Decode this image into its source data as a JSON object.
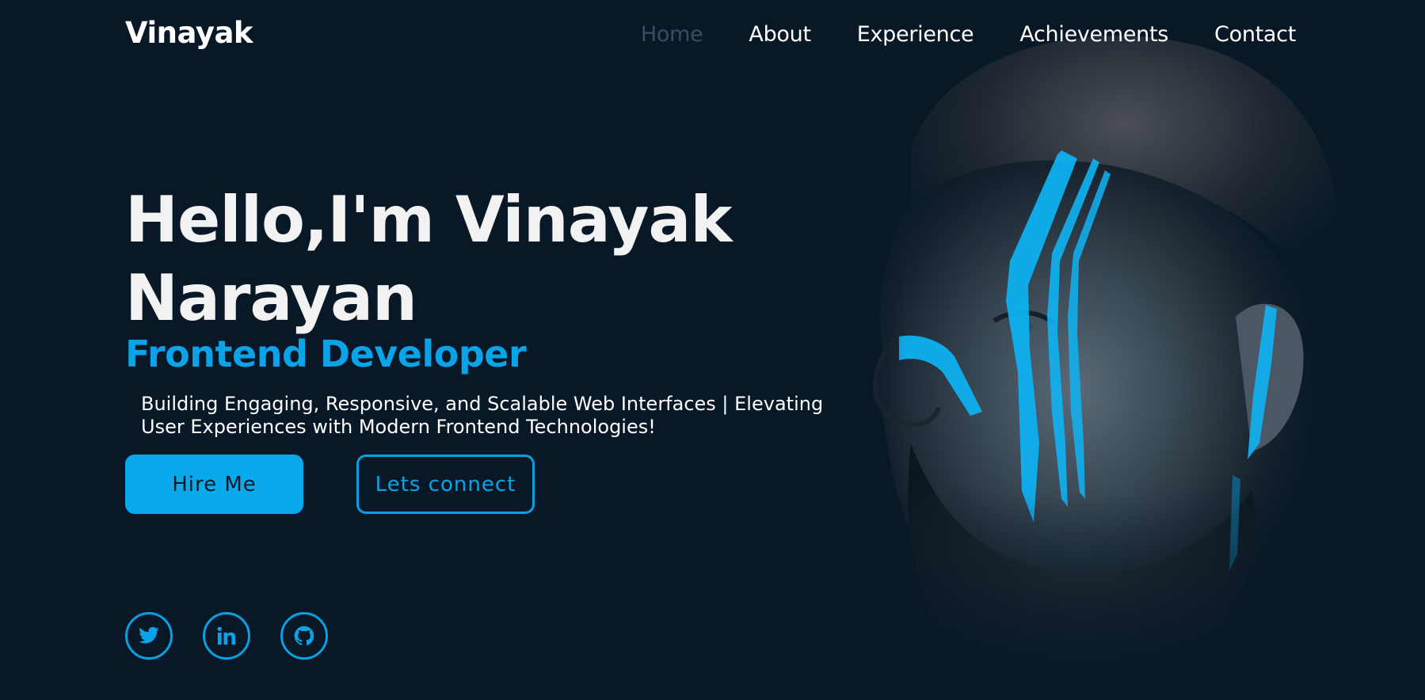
{
  "header": {
    "logo": "Vinayak",
    "nav": [
      {
        "label": "Home",
        "active": true
      },
      {
        "label": "About",
        "active": false
      },
      {
        "label": "Experience",
        "active": false
      },
      {
        "label": "Achievements",
        "active": false
      },
      {
        "label": "Contact",
        "active": false
      }
    ]
  },
  "hero": {
    "title_line1": "Hello,I'm Vinayak",
    "title_line2": "Narayan",
    "role": "Frontend Developer",
    "description": "Building Engaging, Responsive, and Scalable Web Interfaces | Elevating User Experiences with Modern Frontend Technologies!",
    "primary_button": "Hire Me",
    "secondary_button": "Lets connect"
  },
  "socials": [
    {
      "icon": "twitter-icon"
    },
    {
      "icon": "linkedin-icon"
    },
    {
      "icon": "github-icon"
    }
  ],
  "colors": {
    "background": "#081826",
    "accent": "#0aa3e8",
    "nav_active": "#3a4d5c",
    "text": "#ffffff"
  }
}
